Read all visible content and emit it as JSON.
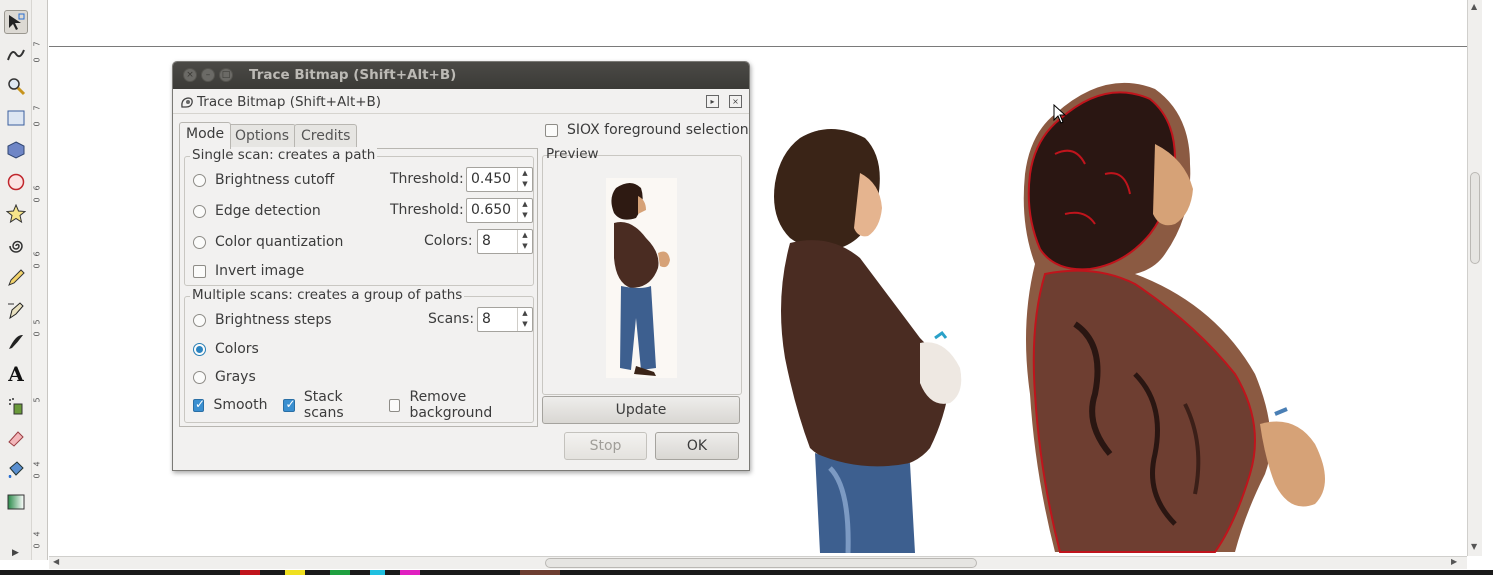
{
  "dialog": {
    "window_title": "Trace Bitmap (Shift+Alt+B)",
    "dock_title": "Trace Bitmap (Shift+Alt+B)",
    "tabs": [
      {
        "label": "Mode",
        "active": true
      },
      {
        "label": "Options",
        "active": false
      },
      {
        "label": "Credits",
        "active": false
      }
    ],
    "single_scan": {
      "title": "Single scan: creates a path",
      "brightness_cutoff": {
        "label": "Brightness cutoff",
        "selected": false,
        "param_label": "Threshold:",
        "value": "0.450"
      },
      "edge_detection": {
        "label": "Edge detection",
        "selected": false,
        "param_label": "Threshold:",
        "value": "0.650"
      },
      "color_quantization": {
        "label": "Color quantization",
        "selected": false,
        "param_label": "Colors:",
        "value": "8"
      },
      "invert_image": {
        "label": "Invert image",
        "checked": false
      }
    },
    "multiple_scans": {
      "title": "Multiple scans: creates a group of paths",
      "brightness_steps": {
        "label": "Brightness steps",
        "selected": false,
        "param_label": "Scans:",
        "value": "8"
      },
      "colors": {
        "label": "Colors",
        "selected": true
      },
      "grays": {
        "label": "Grays",
        "selected": false
      },
      "smooth": {
        "label": "Smooth",
        "checked": true
      },
      "stack_scans": {
        "label": "Stack scans",
        "checked": true
      },
      "remove_background": {
        "label": "Remove background",
        "checked": false
      }
    },
    "siox": {
      "label": "SIOX foreground selection",
      "checked": false
    },
    "preview_label": "Preview",
    "update_button": "Update",
    "stop_button": "Stop",
    "ok_button": "OK"
  },
  "ruler": {
    "ticks": [
      "7",
      "0",
      "7",
      "0",
      "6",
      "0",
      "6",
      "0",
      "5",
      "0",
      "5",
      "4",
      "0",
      "4",
      "0"
    ]
  },
  "colors": {
    "accent": "#2b84c1",
    "titlebar": "#3f3e3b",
    "hoodie": "#4a2c22",
    "trace_outline": "#c0141c",
    "skin": "#d6a277"
  },
  "tools": [
    "selector-icon",
    "tweak-icon",
    "zoom-icon",
    "rectangle-icon",
    "3d-box-icon",
    "ellipse-icon",
    "star-icon",
    "spiral-icon",
    "pencil-icon",
    "pen-icon",
    "calligraphy-icon",
    "text-icon",
    "spray-icon",
    "eraser-icon",
    "paint-bucket-icon",
    "gradient-icon"
  ]
}
